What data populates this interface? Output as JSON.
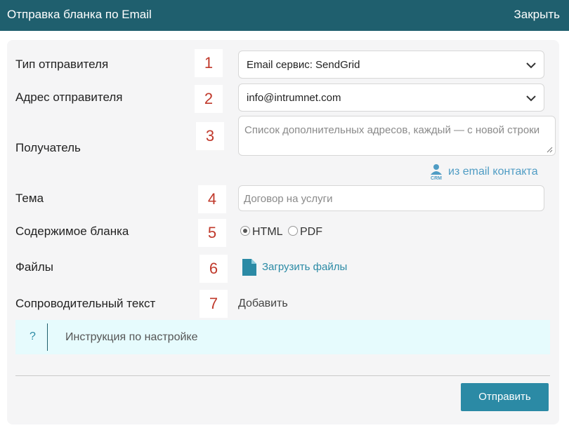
{
  "header": {
    "title": "Отправка бланка по Email",
    "close_label": "Закрыть"
  },
  "form": {
    "sender_type": {
      "label": "Тип отправителя",
      "num": "1",
      "value": "Email сервис: SendGrid"
    },
    "sender_address": {
      "label": "Адрес отправителя",
      "num": "2",
      "value": "info@intrumnet.com"
    },
    "recipient": {
      "label": "Получатель",
      "num": "3",
      "placeholder": "Список дополнительных адресов, каждый — с новой строки",
      "crm_link": "из email контакта"
    },
    "subject": {
      "label": "Тема",
      "num": "4",
      "value": "Договор на услуги"
    },
    "content": {
      "label": "Содержимое бланка",
      "num": "5",
      "options": [
        "HTML",
        "PDF"
      ],
      "selected": "HTML"
    },
    "files": {
      "label": "Файлы",
      "num": "6",
      "upload_label": "Загрузить файлы"
    },
    "cover_text": {
      "label": "Сопроводительный текст",
      "num": "7",
      "add_label": "Добавить"
    }
  },
  "instruction": {
    "icon": "?",
    "text": "Инструкция по настройке"
  },
  "footer": {
    "send_label": "Отправить"
  },
  "colors": {
    "header_bg": "#1f5f6e",
    "accent": "#2b8aa5",
    "number": "#c0392b",
    "link": "#4f9cc4"
  }
}
